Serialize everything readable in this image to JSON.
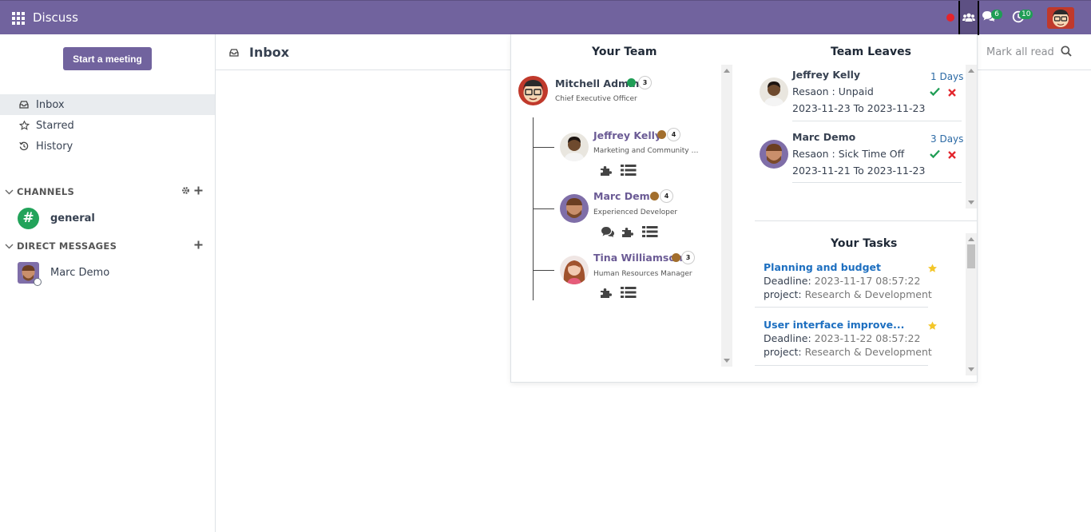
{
  "navbar": {
    "app_name": "Discuss",
    "messages_badge": "6",
    "activities_badge": "10",
    "brand_color": "#71639e"
  },
  "sidebar": {
    "start_meeting": "Start a meeting",
    "items": [
      {
        "label": "Inbox",
        "icon": "inbox-icon",
        "active": true
      },
      {
        "label": "Starred",
        "icon": "star-outline-icon"
      },
      {
        "label": "History",
        "icon": "history-icon"
      }
    ],
    "channels_header": "CHANNELS",
    "channels": [
      {
        "label": "general"
      }
    ],
    "dm_header": "DIRECT MESSAGES",
    "direct_messages": [
      {
        "label": "Marc Demo"
      }
    ]
  },
  "main": {
    "title": "Inbox",
    "mark_all_read": "Mark all read"
  },
  "team": {
    "title": "Your Team",
    "manager": {
      "name": "Mitchell Admin",
      "role": "Chief Executive Officer",
      "count": "3",
      "status_color": "#1f9d55"
    },
    "members": [
      {
        "name": "Jeffrey Kelly",
        "role": "Marketing and Community Ma...",
        "count": "4",
        "status_color": "#a26e2c"
      },
      {
        "name": "Marc Demo",
        "role": "Experienced Developer",
        "count": "4",
        "status_color": "#a26e2c"
      },
      {
        "name": "Tina Williamson",
        "role": "Human Resources Manager",
        "count": "3",
        "status_color": "#a26e2c"
      }
    ]
  },
  "leaves": {
    "title": "Team Leaves",
    "items": [
      {
        "name": "Jeffrey Kelly",
        "days": "1 Days",
        "reason": "Resaon : Unpaid",
        "range": "2023-11-23 To 2023-11-23"
      },
      {
        "name": "Marc Demo",
        "days": "3 Days",
        "reason": "Resaon : Sick Time Off",
        "range": "2023-11-21 To 2023-11-23"
      }
    ]
  },
  "tasks": {
    "title": "Your Tasks",
    "deadline_label": "Deadline:",
    "project_label": "project:",
    "items": [
      {
        "title": "Planning and budget",
        "deadline": "2023-11-17 08:57:22",
        "project": "Research & Development"
      },
      {
        "title": "User interface improve...",
        "deadline": "2023-11-22 08:57:22",
        "project": "Research & Development"
      }
    ]
  }
}
